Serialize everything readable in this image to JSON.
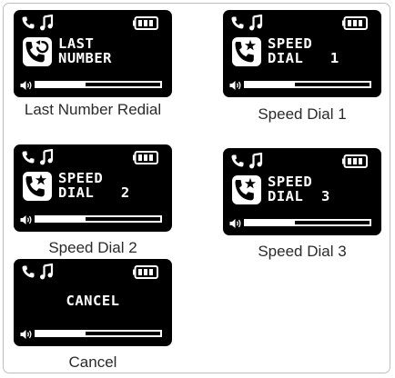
{
  "colors": {
    "screen_bg": "#000000",
    "screen_fg": "#ffffff",
    "caption": "#2a2a2a",
    "frame_border": "#bdbdbd"
  },
  "icons": [
    "phone-icon",
    "music-note-icon",
    "battery-icon",
    "contact-redial-icon",
    "contact-star-icon",
    "volume-icon"
  ],
  "screens": [
    {
      "line1": "LAST",
      "line2": "NUMBER",
      "caption": "Last Number Redial",
      "contact_icon": "contact-redial-icon",
      "volume_level": 0.4
    },
    {
      "line1": "SPEED",
      "line2": "DIAL   1",
      "caption": "Speed Dial 1",
      "contact_icon": "contact-star-icon",
      "volume_level": 0.4
    },
    {
      "line1": "SPEED",
      "line2": "DIAL   2",
      "caption": "Speed Dial 2",
      "contact_icon": "contact-star-icon",
      "volume_level": 0.4
    },
    {
      "line1": "SPEED",
      "line2": "DIAL  3",
      "caption": "Speed Dial 3",
      "contact_icon": "contact-star-icon",
      "volume_level": 0.4
    },
    {
      "line1": "CANCEL",
      "line2": "",
      "caption": "Cancel",
      "contact_icon": "",
      "volume_level": 0.4
    }
  ]
}
